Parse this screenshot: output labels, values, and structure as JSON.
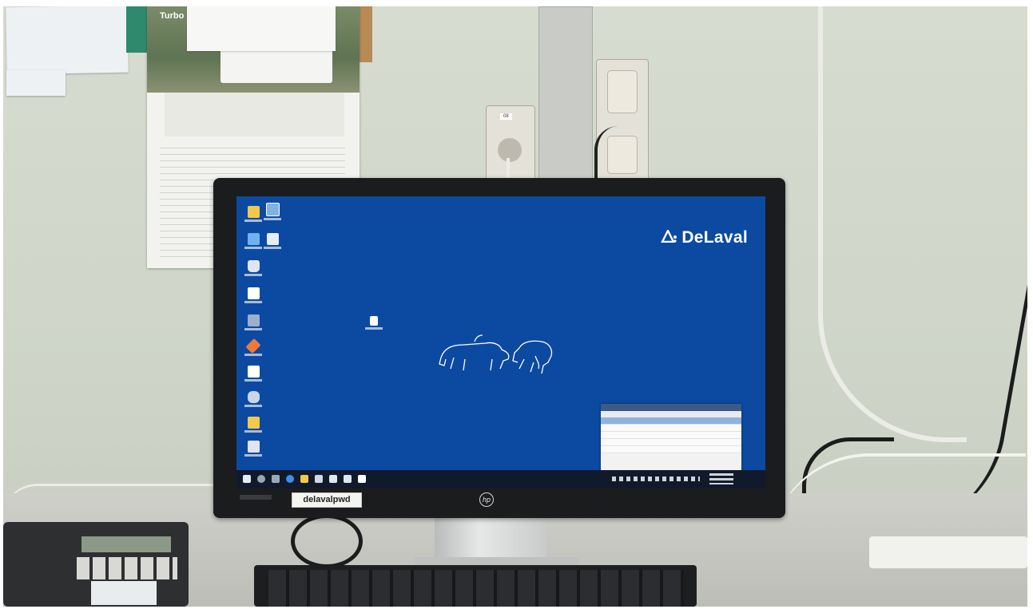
{
  "monitor": {
    "sticker_text": "delavalpwd",
    "bezel_logo": "hp"
  },
  "desktop": {
    "background_color": "#0c4aa2",
    "brand_text": "DeLaval",
    "brand_mark_icon": "delaval-logo-icon",
    "wallpaper_illustration": "cows-line-art",
    "icons": [
      {
        "name": "folder-icon",
        "color": "#f2c94c"
      },
      {
        "name": "network-icon",
        "color": "#7fb3e6"
      },
      {
        "name": "this-pc-icon",
        "color": "#6fb2f0"
      },
      {
        "name": "document-icon",
        "color": "#e8eef7"
      },
      {
        "name": "recycle-bin-icon",
        "color": "#dfe6ef"
      },
      {
        "name": "text-file-icon",
        "color": "#ffffff"
      },
      {
        "name": "app-icon",
        "color": "#9ab0cc"
      },
      {
        "name": "tools-icon",
        "color": "#f07a3a"
      },
      {
        "name": "delaval-app-icon",
        "color": "#ffffff"
      },
      {
        "name": "database-icon",
        "color": "#c9d6e8"
      },
      {
        "name": "folder-icon-2",
        "color": "#f2c94c"
      },
      {
        "name": "shortcut-icon",
        "color": "#dfe6ef"
      },
      {
        "name": "center-app-icon",
        "color": "#ffffff"
      }
    ]
  },
  "taskbar": {
    "background_color": "#111a2b",
    "icons": [
      "start-icon",
      "search-icon",
      "task-view-icon",
      "edge-icon",
      "explorer-icon",
      "store-icon",
      "app-icon",
      "app-icon-2",
      "app-icon-3"
    ]
  },
  "calendar": {
    "title": "Turbo"
  },
  "wall_socket": {
    "label": "08"
  }
}
